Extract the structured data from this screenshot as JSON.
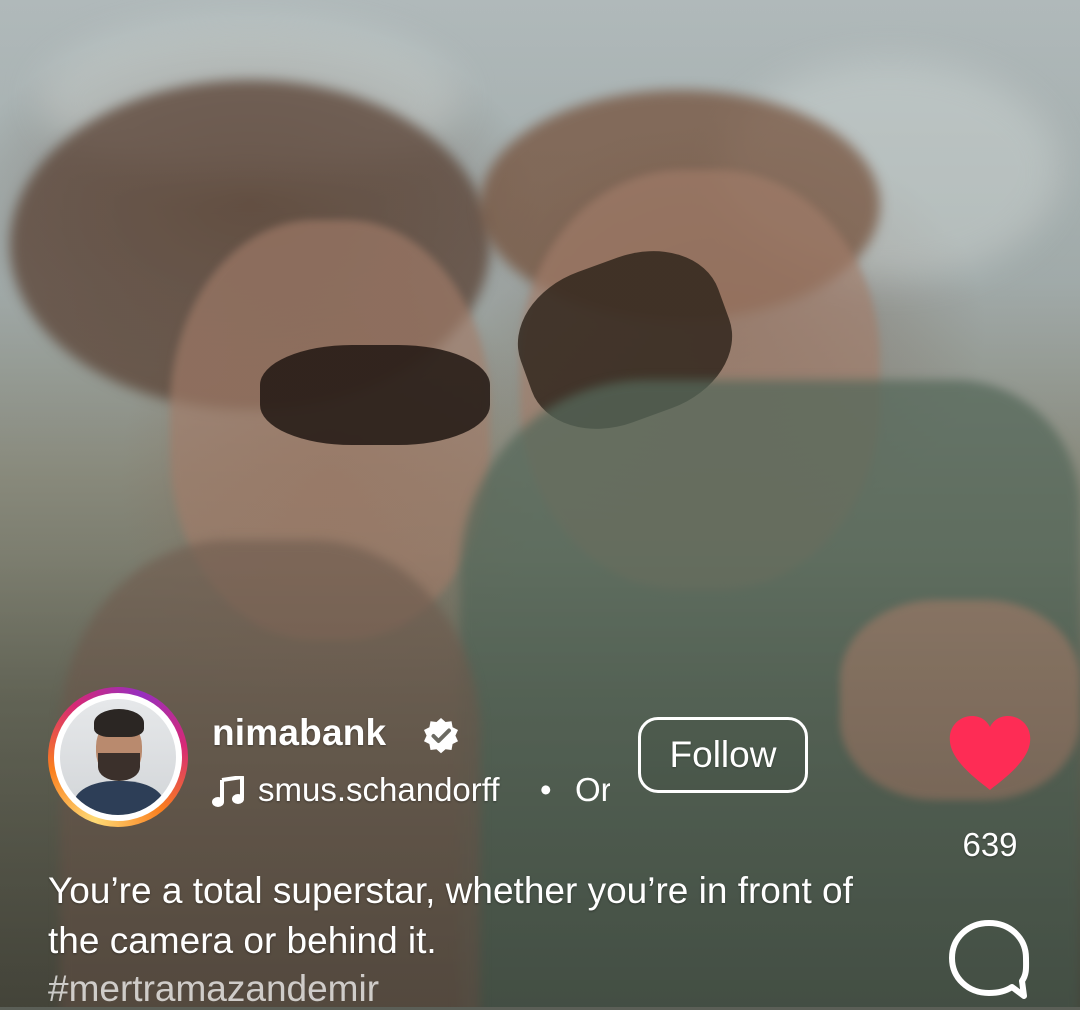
{
  "post": {
    "username": "nimabank",
    "verified_icon": "verified-badge-icon",
    "music_icon": "music-note-icon",
    "music_text": "smus.schandorff",
    "music_separator": "•",
    "music_extra": "Or",
    "follow_label": "Follow",
    "caption": "You’re a total superstar, whether you’re in front of the camera or behind it.",
    "hashtag": "#mertramazandemir"
  },
  "actions": {
    "like_icon": "heart-icon",
    "like_color": "#fe2c55",
    "like_count": "639",
    "comment_icon": "comment-icon"
  }
}
